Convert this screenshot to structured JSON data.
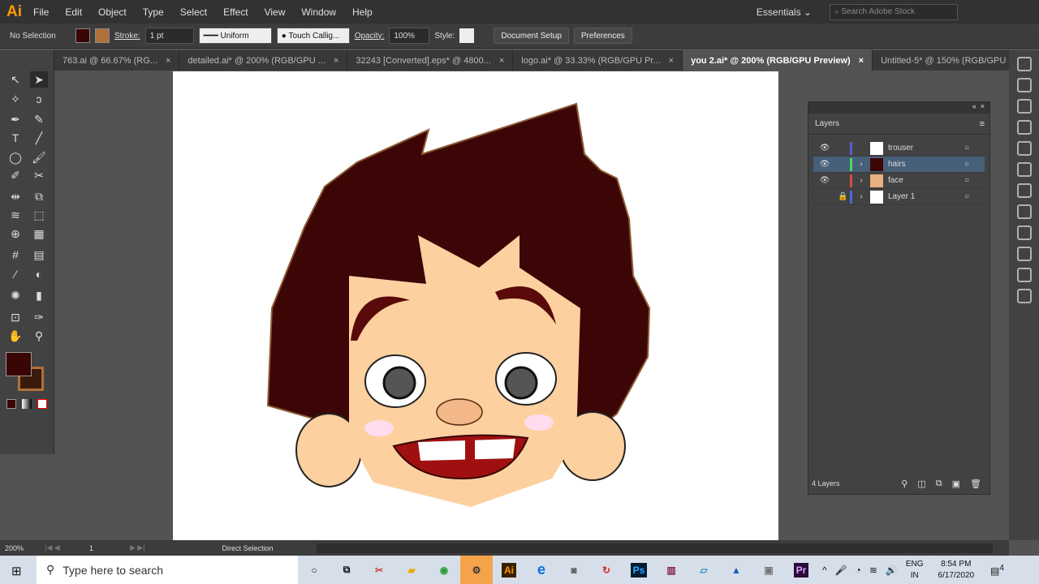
{
  "app": {
    "logo": "Ai",
    "menu": [
      "File",
      "Edit",
      "Object",
      "Type",
      "Select",
      "Effect",
      "View",
      "Window",
      "Help"
    ],
    "workspace": "Essentials",
    "search_placeholder": "Search Adobe Stock"
  },
  "control": {
    "selection": "No Selection",
    "stroke_label": "Stroke:",
    "stroke_value": "1 pt",
    "profile": "Uniform",
    "brush": "Touch Callig...",
    "opacity_label": "Opacity:",
    "opacity_value": "100%",
    "style_label": "Style:",
    "document_setup": "Document Setup",
    "preferences": "Preferences",
    "fill_color": "#3a0505",
    "stroke_color": "#b0713a"
  },
  "tabs": [
    {
      "label": "763.ai @ 66.67% (RG..."
    },
    {
      "label": "detailed.ai* @ 200% (RGB/GPU ..."
    },
    {
      "label": "32243 [Converted].eps* @ 4800..."
    },
    {
      "label": "logo.ai* @ 33.33% (RGB/GPU Pr..."
    },
    {
      "label": "you 2.ai* @ 200% (RGB/GPU Preview)",
      "active": true
    },
    {
      "label": "Untitled-5* @ 150% (RGB/GPU ..."
    }
  ],
  "layers": {
    "title": "Layers",
    "count": "4 Layers",
    "items": [
      {
        "name": "trouser",
        "color": "#5a5ad8"
      },
      {
        "name": "hairs",
        "color": "#4cd860",
        "selected": true
      },
      {
        "name": "face",
        "color": "#d84a4a"
      },
      {
        "name": "Layer 1",
        "color": "#4a6ad8",
        "locked": true
      }
    ]
  },
  "status": {
    "zoom": "200%",
    "artboard": "1",
    "tool": "Direct Selection"
  },
  "taskbar": {
    "search": "Type here to search",
    "lang1": "ENG",
    "lang2": "IN",
    "time": "8:54 PM",
    "date": "6/17/2020",
    "notifications": "4",
    "apps": [
      "Ai",
      "e",
      "Ps",
      "Pr"
    ]
  }
}
